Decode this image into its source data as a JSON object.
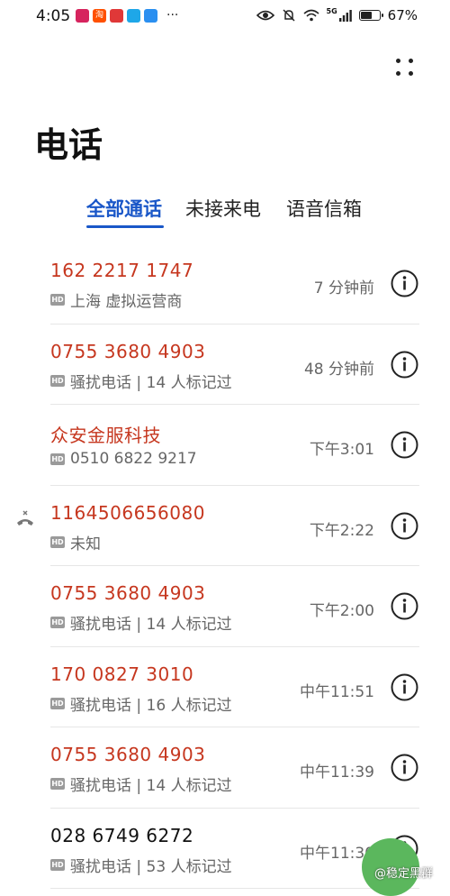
{
  "status_bar": {
    "time": "4:05",
    "app_icons": [
      {
        "label": "",
        "color": "#d6245e",
        "name": "app-icon-1"
      },
      {
        "label": "淘",
        "color": "#ff5000",
        "name": "taobao-icon"
      },
      {
        "label": "",
        "color": "#e03838",
        "name": "app-icon-3"
      },
      {
        "label": "",
        "color": "#1ea7e8",
        "name": "search-app-icon"
      },
      {
        "label": "",
        "color": "#2a8ff0",
        "name": "weibo-app-icon"
      }
    ],
    "more": "···",
    "network": "5G",
    "battery_percent": "67%",
    "battery_level": 0.67
  },
  "header": {
    "title": "电话"
  },
  "tabs": [
    {
      "label": "全部通话",
      "active": true
    },
    {
      "label": "未接来电",
      "active": false
    },
    {
      "label": "语音信箱",
      "active": false
    }
  ],
  "calls": [
    {
      "name": "162 2217 1747",
      "hd": "HD",
      "sub": "上海 虚拟运营商",
      "time": "7 分钟前",
      "missed": false,
      "highlight": true
    },
    {
      "name": "0755 3680 4903",
      "hd": "HD",
      "sub": "骚扰电话 | 14 人标记过",
      "time": "48 分钟前",
      "missed": false,
      "highlight": true
    },
    {
      "name": "众安金服科技",
      "hd": "HD",
      "sub": "0510 6822 9217",
      "time": "下午3:01",
      "missed": false,
      "highlight": true
    },
    {
      "name": "1164506656080",
      "hd": "HD",
      "sub": "未知",
      "time": "下午2:22",
      "missed": true,
      "highlight": true
    },
    {
      "name": "0755 3680 4903",
      "hd": "HD",
      "sub": "骚扰电话 | 14 人标记过",
      "time": "下午2:00",
      "missed": false,
      "highlight": true
    },
    {
      "name": "170 0827 3010",
      "hd": "HD",
      "sub": "骚扰电话 | 16 人标记过",
      "time": "中午11:51",
      "missed": false,
      "highlight": true
    },
    {
      "name": "0755 3680 4903",
      "hd": "HD",
      "sub": "骚扰电话 | 14 人标记过",
      "time": "中午11:39",
      "missed": false,
      "highlight": true
    },
    {
      "name": "028 6749 6272",
      "hd": "HD",
      "sub": "骚扰电话 | 53 人标记过",
      "time": "中午11:30",
      "missed": false,
      "highlight": false
    }
  ],
  "watermark": {
    "text": "@稳定黑群"
  },
  "colors": {
    "accent": "#1a57c8",
    "flagged": "#c6371f"
  }
}
